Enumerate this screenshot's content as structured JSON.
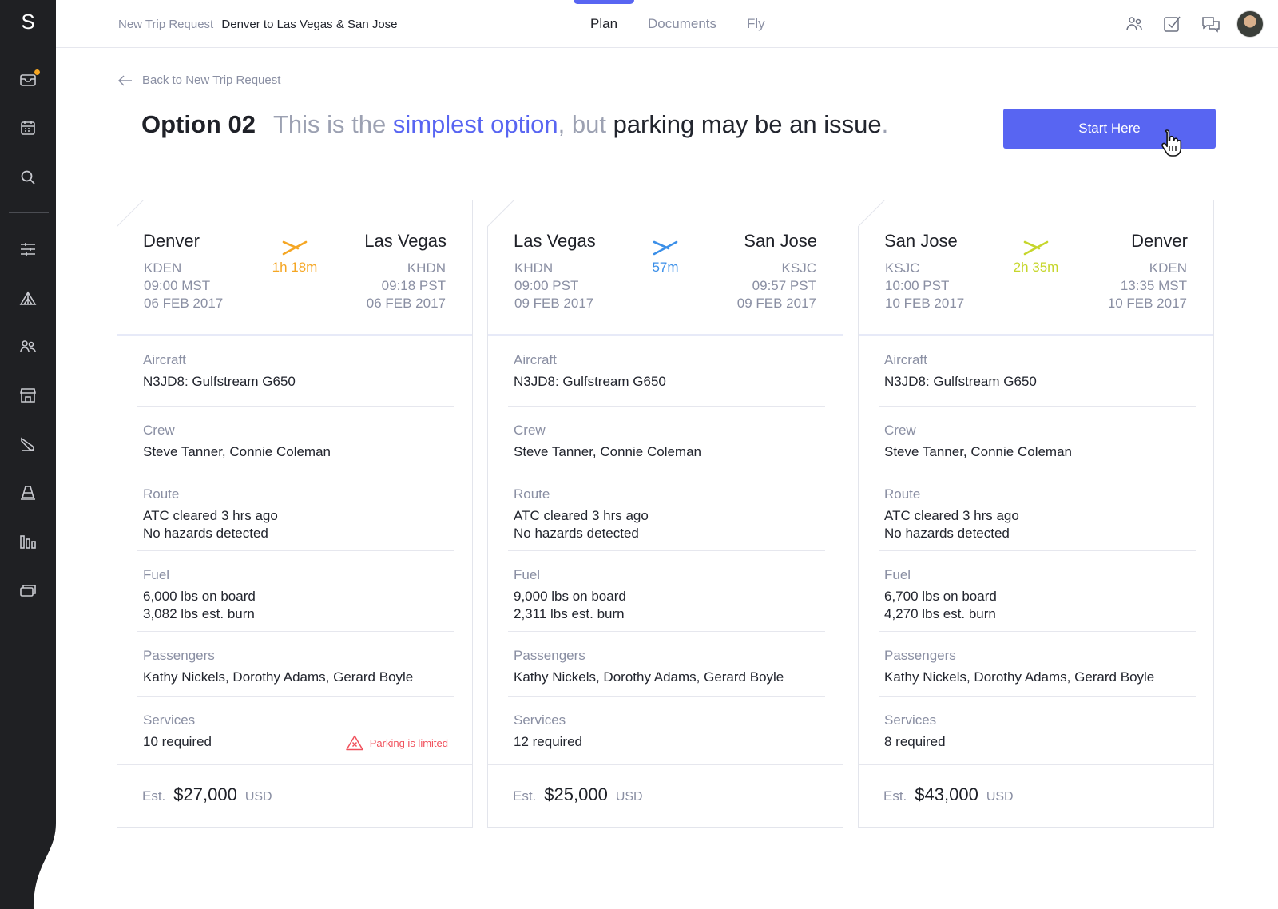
{
  "sidebar": {
    "logo": "S",
    "icons": [
      "inbox-icon",
      "calendar-icon",
      "search-icon",
      "sliders-icon",
      "tent-icon",
      "users-icon",
      "store-icon",
      "plane-icon",
      "cone-icon",
      "bars-icon",
      "cards-icon"
    ],
    "notification_color": "#f5a623"
  },
  "header": {
    "crumb_label": "New Trip Request",
    "crumb_title": "Denver to Las Vegas & San Jose",
    "tabs": [
      {
        "label": "Plan",
        "active": true
      },
      {
        "label": "Documents",
        "active": false
      },
      {
        "label": "Fly",
        "active": false
      }
    ],
    "icons": [
      "team-icon",
      "check-icon",
      "chat-icon",
      "avatar"
    ]
  },
  "main": {
    "back_label": "Back to New Trip Request",
    "option_title": "Option 02",
    "desc_part1": "This is the ",
    "desc_highlight": "simplest option",
    "desc_part2": ", but ",
    "desc_strong": "parking may be an issue",
    "desc_end": ".",
    "start_button": "Start Here",
    "accent_color": "#5865f2"
  },
  "cards": [
    {
      "from": "Denver",
      "to": "Las Vegas",
      "duration": "1h 18m",
      "color": "#f5a623",
      "from_code": "KDEN",
      "from_time": "09:00 MST",
      "from_date": "06 FEB 2017",
      "to_code": "KHDN",
      "to_time": "09:18 PST",
      "to_date": "06 FEB 2017",
      "aircraft_label": "Aircraft",
      "aircraft": "N3JD8: Gulfstream G650",
      "crew_label": "Crew",
      "crew": "Steve Tanner, Connie Coleman",
      "route_label": "Route",
      "route_1": "ATC cleared 3 hrs ago",
      "route_2": "No hazards detected",
      "fuel_label": "Fuel",
      "fuel_1": "6,000 lbs on board",
      "fuel_2": "3,082 lbs est. burn",
      "pax_label": "Passengers",
      "pax": "Kathy Nickels, Dorothy Adams, Gerard Boyle",
      "services_label": "Services",
      "services": "10 required",
      "warning": "Parking is limited",
      "est_label": "Est.",
      "price": "$27,000",
      "currency": "USD"
    },
    {
      "from": "Las Vegas",
      "to": "San Jose",
      "duration": "57m",
      "color": "#3b8fe8",
      "from_code": "KHDN",
      "from_time": "09:00 PST",
      "from_date": "09 FEB 2017",
      "to_code": "KSJC",
      "to_time": "09:57 PST",
      "to_date": "09 FEB 2017",
      "aircraft_label": "Aircraft",
      "aircraft": "N3JD8: Gulfstream G650",
      "crew_label": "Crew",
      "crew": "Steve Tanner, Connie Coleman",
      "route_label": "Route",
      "route_1": "ATC cleared 3 hrs ago",
      "route_2": "No hazards detected",
      "fuel_label": "Fuel",
      "fuel_1": "9,000 lbs on board",
      "fuel_2": "2,311 lbs est. burn",
      "pax_label": "Passengers",
      "pax": "Kathy Nickels, Dorothy Adams, Gerard Boyle",
      "services_label": "Services",
      "services": "12 required",
      "warning": "",
      "est_label": "Est.",
      "price": "$25,000",
      "currency": "USD"
    },
    {
      "from": "San Jose",
      "to": "Denver",
      "duration": "2h 35m",
      "color": "#c6d62c",
      "from_code": "KSJC",
      "from_time": "10:00 PST",
      "from_date": "10 FEB 2017",
      "to_code": "KDEN",
      "to_time": "13:35 MST",
      "to_date": "10 FEB 2017",
      "aircraft_label": "Aircraft",
      "aircraft": "N3JD8: Gulfstream G650",
      "crew_label": "Crew",
      "crew": "Steve Tanner, Connie Coleman",
      "route_label": "Route",
      "route_1": "ATC cleared 3 hrs ago",
      "route_2": "No hazards detected",
      "fuel_label": "Fuel",
      "fuel_1": "6,700 lbs on board",
      "fuel_2": "4,270 lbs est. burn",
      "pax_label": "Passengers",
      "pax": "Kathy Nickels, Dorothy Adams, Gerard Boyle",
      "services_label": "Services",
      "services": "8 required",
      "warning": "",
      "est_label": "Est.",
      "price": "$43,000",
      "currency": "USD"
    }
  ]
}
